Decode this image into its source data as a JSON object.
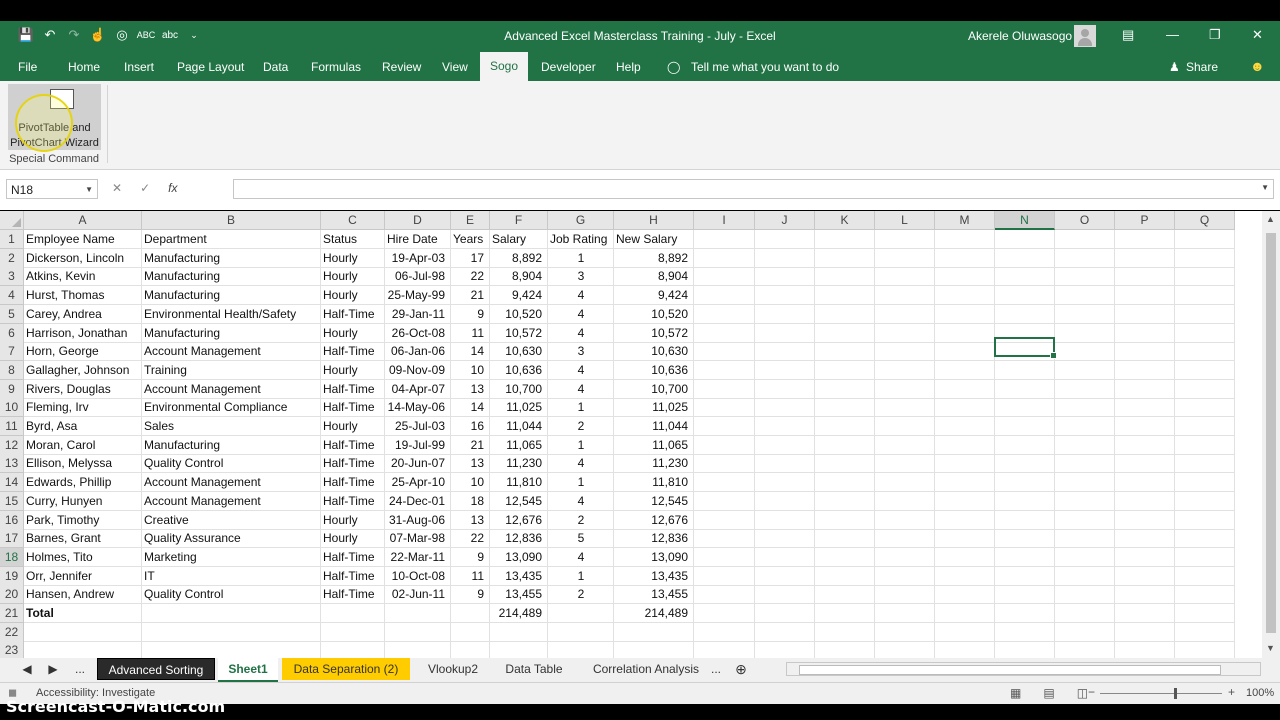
{
  "window": {
    "title": "Advanced Excel Masterclass Training - July  -  Excel",
    "user": "Akerele Oluwasogo"
  },
  "ribbon_tabs": [
    "File",
    "Home",
    "Insert",
    "Page Layout",
    "Data",
    "Formulas",
    "Review",
    "View",
    "Sogo",
    "Developer",
    "Help"
  ],
  "active_tab": "Sogo",
  "tell_me": "Tell me what you want to do",
  "share": "Share",
  "ribbon": {
    "button_label_1": "PivotTable and",
    "button_label_2": "PivotChart Wizard",
    "group_label": "Special Command"
  },
  "formula_bar": {
    "name_box": "N18",
    "fx": "fx",
    "value": ""
  },
  "columns": [
    "A",
    "B",
    "C",
    "D",
    "E",
    "F",
    "G",
    "H",
    "I",
    "J",
    "K",
    "L",
    "M",
    "N",
    "O",
    "P",
    "Q"
  ],
  "selected_column": "N",
  "selected_row": 18,
  "headers": [
    "Employee Name",
    "Department",
    "Status",
    "Hire Date",
    "Years",
    "Salary",
    "Job Rating",
    "New Salary"
  ],
  "rows": [
    [
      "Dickerson, Lincoln",
      "Manufacturing",
      "Hourly",
      "19-Apr-03",
      "17",
      "8,892",
      "1",
      "8,892"
    ],
    [
      "Atkins, Kevin",
      "Manufacturing",
      "Hourly",
      "06-Jul-98",
      "22",
      "8,904",
      "3",
      "8,904"
    ],
    [
      "Hurst, Thomas",
      "Manufacturing",
      "Hourly",
      "25-May-99",
      "21",
      "9,424",
      "4",
      "9,424"
    ],
    [
      "Carey, Andrea",
      "Environmental Health/Safety",
      "Half-Time",
      "29-Jan-11",
      "9",
      "10,520",
      "4",
      "10,520"
    ],
    [
      "Harrison, Jonathan",
      "Manufacturing",
      "Hourly",
      "26-Oct-08",
      "11",
      "10,572",
      "4",
      "10,572"
    ],
    [
      "Horn, George",
      "Account Management",
      "Half-Time",
      "06-Jan-06",
      "14",
      "10,630",
      "3",
      "10,630"
    ],
    [
      "Gallagher, Johnson",
      "Training",
      "Hourly",
      "09-Nov-09",
      "10",
      "10,636",
      "4",
      "10,636"
    ],
    [
      "Rivers, Douglas",
      "Account Management",
      "Half-Time",
      "04-Apr-07",
      "13",
      "10,700",
      "4",
      "10,700"
    ],
    [
      "Fleming, Irv",
      "Environmental Compliance",
      "Half-Time",
      "14-May-06",
      "14",
      "11,025",
      "1",
      "11,025"
    ],
    [
      "Byrd, Asa",
      "Sales",
      "Hourly",
      "25-Jul-03",
      "16",
      "11,044",
      "2",
      "11,044"
    ],
    [
      "Moran, Carol",
      "Manufacturing",
      "Half-Time",
      "19-Jul-99",
      "21",
      "11,065",
      "1",
      "11,065"
    ],
    [
      "Ellison, Melyssa",
      "Quality Control",
      "Half-Time",
      "20-Jun-07",
      "13",
      "11,230",
      "4",
      "11,230"
    ],
    [
      "Edwards, Phillip",
      "Account Management",
      "Half-Time",
      "25-Apr-10",
      "10",
      "11,810",
      "1",
      "11,810"
    ],
    [
      "Curry, Hunyen",
      "Account Management",
      "Half-Time",
      "24-Dec-01",
      "18",
      "12,545",
      "4",
      "12,545"
    ],
    [
      "Park, Timothy",
      "Creative",
      "Hourly",
      "31-Aug-06",
      "13",
      "12,676",
      "2",
      "12,676"
    ],
    [
      "Barnes, Grant",
      "Quality Assurance",
      "Hourly",
      "07-Mar-98",
      "22",
      "12,836",
      "5",
      "12,836"
    ],
    [
      "Holmes, Tito",
      "Marketing",
      "Half-Time",
      "22-Mar-11",
      "9",
      "13,090",
      "4",
      "13,090"
    ],
    [
      "Orr, Jennifer",
      "IT",
      "Half-Time",
      "10-Oct-08",
      "11",
      "13,435",
      "1",
      "13,435"
    ],
    [
      "Hansen, Andrew",
      "Quality Control",
      "Half-Time",
      "02-Jun-11",
      "9",
      "13,455",
      "2",
      "13,455"
    ]
  ],
  "total_row": {
    "label": "Total",
    "salary": "214,489",
    "new_salary": "214,489"
  },
  "row_numbers": [
    "1",
    "2",
    "3",
    "4",
    "5",
    "6",
    "7",
    "8",
    "9",
    "10",
    "11",
    "12",
    "13",
    "14",
    "15",
    "16",
    "17",
    "18",
    "19",
    "20",
    "21",
    "22",
    "23"
  ],
  "sheet_tabs": {
    "ellipsis": "...",
    "tabs": [
      "Advanced Sorting",
      "Sheet1",
      "Data Separation (2)",
      "Vlookup2",
      "Data Table",
      "Correlation Analysis"
    ],
    "more": "..."
  },
  "status": {
    "accessibility": "Accessibility: Investigate",
    "zoom": "100%"
  },
  "watermark": "Screencast-O-Matic.com",
  "colors": {
    "excel_green": "#217346",
    "selected_tab_yellow": "#ffcc00"
  }
}
